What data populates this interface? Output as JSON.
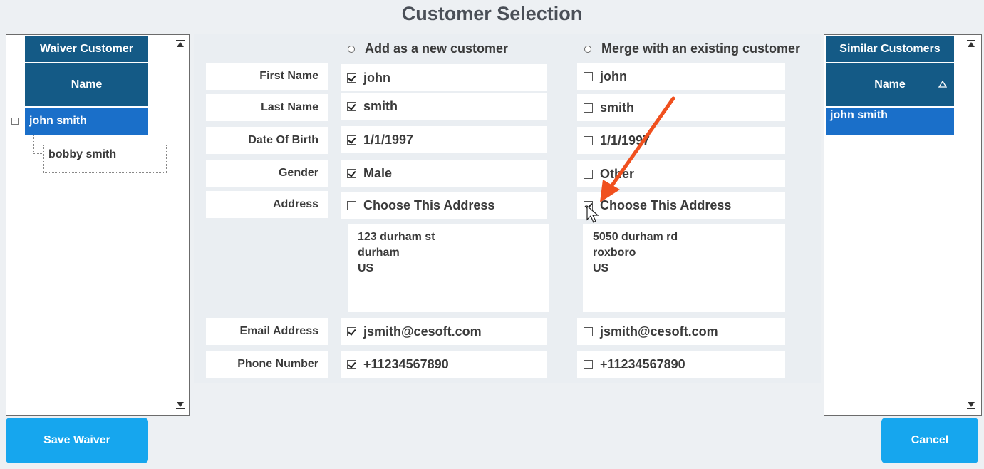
{
  "title": "Customer Selection",
  "waiver_panel": {
    "header": "Waiver Customer",
    "column": "Name",
    "selected": "john smith",
    "child": "bobby smith"
  },
  "similar_panel": {
    "header": "Similar Customers",
    "column": "Name",
    "selected": "john smith"
  },
  "options": {
    "new": "Add as a new customer",
    "merge": "Merge with an existing customer"
  },
  "fields": {
    "first_name": "First Name",
    "last_name": "Last Name",
    "dob": "Date Of Birth",
    "gender": "Gender",
    "address": "Address",
    "email": "Email Address",
    "phone": "Phone Number"
  },
  "new_customer": {
    "first_name": "john",
    "last_name": "smith",
    "dob": "1/1/1997",
    "gender": "Male",
    "address_choose": "Choose This Address",
    "address_line1": "123 durham st",
    "address_line2": "durham",
    "address_line3": "US",
    "email": "jsmith@cesoft.com",
    "phone": "+11234567890"
  },
  "existing_customer": {
    "first_name": "john",
    "last_name": "smith",
    "dob": "1/1/1997",
    "gender": "Other",
    "address_choose": "Choose This Address",
    "address_line1": "5050 durham rd",
    "address_line2": "roxboro",
    "address_line3": "US",
    "email": "jsmith@cesoft.com",
    "phone": "+11234567890"
  },
  "buttons": {
    "save": "Save Waiver",
    "cancel": "Cancel"
  },
  "colors": {
    "header": "#145a86",
    "selected": "#1a6fc9",
    "button": "#16a6ee",
    "annotation_arrow": "#f0501e"
  }
}
